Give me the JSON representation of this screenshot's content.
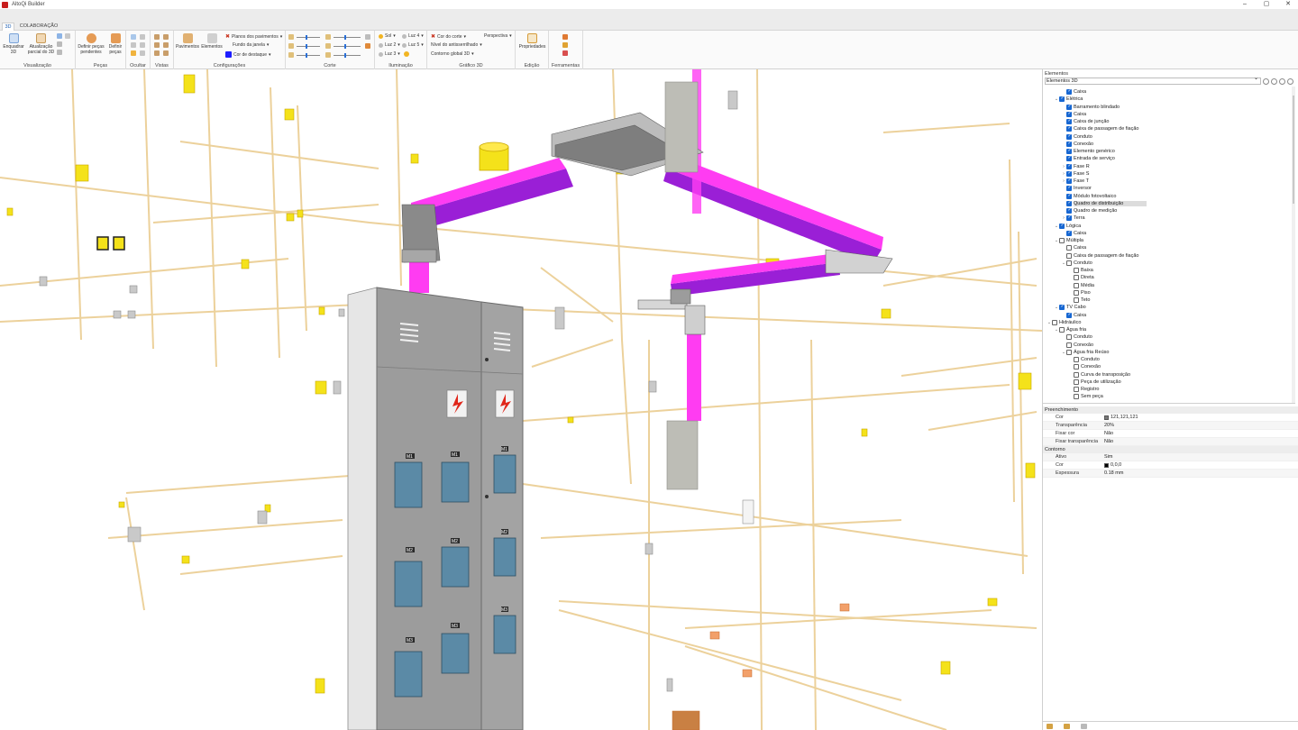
{
  "window": {
    "title": "AltoQi Builder",
    "controls": [
      "–",
      "▢",
      "✕"
    ]
  },
  "tabs": [
    {
      "label": "3D",
      "active": true
    },
    {
      "label": "COLABORAÇÃO",
      "active": false
    }
  ],
  "ribbon": {
    "visualizacao": {
      "label": "Visualização",
      "enquadrar": "Enquadrar 3D",
      "atualizacao": "Atualização parcial do 3D"
    },
    "pecas": {
      "label": "Peças",
      "definir_pendentes": "Definir peças pendentes",
      "definir_pecas": "Definir peças"
    },
    "ocultar": {
      "label": "Ocultar"
    },
    "vistas": {
      "label": "Vistas"
    },
    "configuracoes": {
      "label": "Configurações",
      "pavimentos": "Pavimentos",
      "elementos": "Elementos",
      "planos": "Planos dos pavimentos",
      "fundo": "Fundo da janela",
      "destaque": "Cor de destaque"
    },
    "corte": {
      "label": "Corte"
    },
    "iluminacao": {
      "label": "Iluminação",
      "sol": "Sol",
      "luz2": "Luz 2",
      "luz3": "Luz 3",
      "luz4": "Luz 4",
      "luz5": "Luz 5"
    },
    "grafico": {
      "label": "Gráfico 3D",
      "cor_corte": "Cor do corte",
      "antiserrilhado": "Nível do antisserrilhado",
      "contorno": "Contorno global 3D",
      "perspectiva": "Perspectiva"
    },
    "edicao": {
      "label": "Edição",
      "propriedades": "Propriedades"
    },
    "ferramentas": {
      "label": "Ferramentas"
    }
  },
  "panel": {
    "title": "Elementos",
    "select_value": "Elementos 3D",
    "tree": [
      {
        "label": "Caixa",
        "level": 3,
        "checked": true,
        "expander": ""
      },
      {
        "label": "Elétrica",
        "level": 2,
        "checked": true,
        "expander": "⌄"
      },
      {
        "label": "Barramento blindado",
        "level": 3,
        "checked": true,
        "expander": ""
      },
      {
        "label": "Caixa",
        "level": 3,
        "checked": true,
        "expander": ""
      },
      {
        "label": "Caixa de junção",
        "level": 3,
        "checked": true,
        "expander": ""
      },
      {
        "label": "Caixa de passagem de fiação",
        "level": 3,
        "checked": true,
        "expander": ""
      },
      {
        "label": "Conduto",
        "level": 3,
        "checked": true,
        "expander": ""
      },
      {
        "label": "Conexão",
        "level": 3,
        "checked": true,
        "expander": ""
      },
      {
        "label": "Elemento genérico",
        "level": 3,
        "checked": true,
        "expander": ""
      },
      {
        "label": "Entrada de serviço",
        "level": 3,
        "checked": true,
        "expander": ""
      },
      {
        "label": "Fase R",
        "level": 3,
        "checked": true,
        "expander": "›"
      },
      {
        "label": "Fase S",
        "level": 3,
        "checked": true,
        "expander": "›"
      },
      {
        "label": "Fase T",
        "level": 3,
        "checked": true,
        "expander": "›"
      },
      {
        "label": "Inversor",
        "level": 3,
        "checked": true,
        "expander": ""
      },
      {
        "label": "Módulo fotovoltaico",
        "level": 3,
        "checked": true,
        "expander": ""
      },
      {
        "label": "Quadro de distribuição",
        "level": 3,
        "checked": true,
        "expander": "",
        "selected": true
      },
      {
        "label": "Quadro de medição",
        "level": 3,
        "checked": true,
        "expander": ""
      },
      {
        "label": "Terra",
        "level": 3,
        "checked": true,
        "expander": "›"
      },
      {
        "label": "Lógica",
        "level": 2,
        "checked": true,
        "expander": "⌄"
      },
      {
        "label": "Caixa",
        "level": 3,
        "checked": true,
        "expander": ""
      },
      {
        "label": "Múltipla",
        "level": 2,
        "checked": false,
        "expander": "⌄"
      },
      {
        "label": "Caixa",
        "level": 3,
        "checked": false,
        "expander": ""
      },
      {
        "label": "Caixa de passagem de fiação",
        "level": 3,
        "checked": false,
        "expander": ""
      },
      {
        "label": "Conduto",
        "level": 3,
        "checked": false,
        "expander": "⌄"
      },
      {
        "label": "Baixa",
        "level": 4,
        "checked": false,
        "expander": ""
      },
      {
        "label": "Direta",
        "level": 4,
        "checked": false,
        "expander": ""
      },
      {
        "label": "Média",
        "level": 4,
        "checked": false,
        "expander": ""
      },
      {
        "label": "Piso",
        "level": 4,
        "checked": false,
        "expander": ""
      },
      {
        "label": "Teto",
        "level": 4,
        "checked": false,
        "expander": ""
      },
      {
        "label": "TV Cabo",
        "level": 2,
        "checked": true,
        "expander": "⌄"
      },
      {
        "label": "Caixa",
        "level": 3,
        "checked": true,
        "expander": ""
      },
      {
        "label": "Hidráulico",
        "level": 1,
        "checked": false,
        "expander": "⌄"
      },
      {
        "label": "Água fria",
        "level": 2,
        "checked": false,
        "expander": "⌄"
      },
      {
        "label": "Conduto",
        "level": 3,
        "checked": false,
        "expander": ""
      },
      {
        "label": "Conexão",
        "level": 3,
        "checked": false,
        "expander": ""
      },
      {
        "label": "Água fria Reúso",
        "level": 3,
        "checked": false,
        "expander": "⌄"
      },
      {
        "label": "Conduto",
        "level": 4,
        "checked": false,
        "expander": ""
      },
      {
        "label": "Conexão",
        "level": 4,
        "checked": false,
        "expander": ""
      },
      {
        "label": "Curva de transposição",
        "level": 4,
        "checked": false,
        "expander": ""
      },
      {
        "label": "Peça de utilização",
        "level": 4,
        "checked": false,
        "expander": ""
      },
      {
        "label": "Registro",
        "level": 4,
        "checked": false,
        "expander": ""
      },
      {
        "label": "Sem peça",
        "level": 4,
        "checked": false,
        "expander": ""
      }
    ],
    "properties": [
      {
        "section": "Preenchimento",
        "rows": [
          {
            "key": "Cor",
            "value": "121,121,121",
            "swatch": "#797979"
          },
          {
            "key": "Transparência",
            "value": "20%"
          },
          {
            "key": "Fixar cor",
            "value": "Não"
          },
          {
            "key": "Fixar transparência",
            "value": "Não"
          }
        ]
      },
      {
        "section": "Contorno",
        "rows": [
          {
            "key": "Ativo",
            "value": "Sim"
          },
          {
            "key": "Cor",
            "value": "0,0,0",
            "swatch": "#000000"
          },
          {
            "key": "Espessura",
            "value": "0.18 mm"
          }
        ]
      }
    ]
  },
  "scene": {
    "colors": {
      "conduit": "#e9c98a",
      "box": "#f4e21a",
      "trunking_top": "#ff3cf2",
      "trunking_side": "#9a1fd6",
      "cabinet": "#9c9c9c",
      "meter_window": "#5b8aa6",
      "warning": "#e0271b"
    },
    "labels": {
      "m1": "M1",
      "m2": "M2",
      "m3": "M3"
    }
  }
}
